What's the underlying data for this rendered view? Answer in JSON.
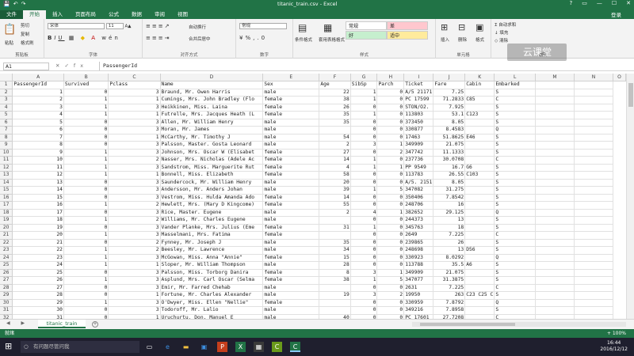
{
  "window": {
    "title": "titanic_train.csv - Excel",
    "login": "登录",
    "qat_icons": [
      "save-icon",
      "undo-icon",
      "redo-icon"
    ],
    "controls": [
      "?",
      "▭",
      "—",
      "☐",
      "✕"
    ]
  },
  "tabs": [
    "文件",
    "开始",
    "插入",
    "页面布局",
    "公式",
    "数据",
    "审阅",
    "视图"
  ],
  "active_tab": "开始",
  "ribbon": {
    "clipboard": {
      "label": "剪贴板",
      "paste": "粘贴",
      "cut": "剪切",
      "copy": "复制",
      "format_painter": "格式刷"
    },
    "font": {
      "label": "字体",
      "name": "宋体",
      "size": "11"
    },
    "alignment": {
      "label": "对齐方式",
      "wrap": "自动换行",
      "merge": "合并后居中"
    },
    "number": {
      "label": "数字",
      "format": "常规"
    },
    "styles": {
      "label": "样式",
      "cond_format": "条件格式",
      "table_format": "套用表格格式",
      "cells": [
        {
          "text": "常规",
          "bg": "#ffffff"
        },
        {
          "text": "差",
          "bg": "#ffc7ce"
        },
        {
          "text": "好",
          "bg": "#c6efce"
        },
        {
          "text": "适中",
          "bg": "#ffeb9c"
        }
      ]
    },
    "cells_grp": {
      "label": "单元格",
      "insert": "插入",
      "delete": "删除",
      "format": "格式"
    },
    "editing": {
      "label": "编辑",
      "autosum": "自动求和",
      "fill": "填充",
      "clear": "清除"
    },
    "brand": "云课堂"
  },
  "formula_bar": {
    "name_box": "A1",
    "value": "PassengerId"
  },
  "grid": {
    "columns": [
      "A",
      "B",
      "C",
      "D",
      "E",
      "F",
      "G",
      "H",
      "I",
      "J",
      "K",
      "L",
      "M",
      "N",
      "O"
    ],
    "rows": [
      [
        "1",
        "PassengerId",
        "Survived",
        "Pclass",
        "Name",
        "Sex",
        "Age",
        "SibSp",
        "Parch",
        "Ticket",
        "Fare",
        "Cabin",
        "Embarked",
        "",
        ""
      ],
      [
        "2",
        "1",
        "0",
        "3",
        "Braund, Mr. Owen Harris",
        "male",
        "22",
        "1",
        "0",
        "A/5 21171",
        "7.25",
        "",
        "S",
        "",
        ""
      ],
      [
        "3",
        "2",
        "1",
        "1",
        "Cumings, Mrs. John Bradley (Flo",
        "female",
        "38",
        "1",
        "0",
        "PC 17599",
        "71.2833",
        "C85",
        "C",
        "",
        ""
      ],
      [
        "4",
        "3",
        "1",
        "3",
        "Heikkinen, Miss. Laina",
        "female",
        "26",
        "0",
        "0",
        "STON/O2.",
        "7.925",
        "",
        "S",
        "",
        ""
      ],
      [
        "5",
        "4",
        "1",
        "1",
        "Futrelle, Mrs. Jacques Heath (L",
        "female",
        "35",
        "1",
        "0",
        "113803",
        "53.1",
        "C123",
        "S",
        "",
        ""
      ],
      [
        "6",
        "5",
        "0",
        "3",
        "Allen, Mr. William Henry",
        "male",
        "35",
        "0",
        "0",
        "373450",
        "8.05",
        "",
        "S",
        "",
        ""
      ],
      [
        "7",
        "6",
        "0",
        "3",
        "Moran, Mr. James",
        "male",
        "",
        "0",
        "0",
        "330877",
        "8.4583",
        "",
        "Q",
        "",
        ""
      ],
      [
        "8",
        "7",
        "0",
        "1",
        "McCarthy, Mr. Timothy J",
        "male",
        "54",
        "0",
        "0",
        "17463",
        "51.8625",
        "E46",
        "S",
        "",
        ""
      ],
      [
        "9",
        "8",
        "0",
        "3",
        "Palsson, Master. Gosta Leonard",
        "male",
        "2",
        "3",
        "1",
        "349909",
        "21.075",
        "",
        "S",
        "",
        ""
      ],
      [
        "10",
        "9",
        "1",
        "3",
        "Johnson, Mrs. Oscar W (Elisabet",
        "female",
        "27",
        "0",
        "2",
        "347742",
        "11.1333",
        "",
        "S",
        "",
        ""
      ],
      [
        "11",
        "10",
        "1",
        "2",
        "Nasser, Mrs. Nicholas (Adele Ac",
        "female",
        "14",
        "1",
        "0",
        "237736",
        "30.0708",
        "",
        "C",
        "",
        ""
      ],
      [
        "12",
        "11",
        "1",
        "3",
        "Sandstrom, Miss. Marguerite Rut",
        "female",
        "4",
        "1",
        "1",
        "PP 9549",
        "16.7",
        "G6",
        "S",
        "",
        ""
      ],
      [
        "13",
        "12",
        "1",
        "1",
        "Bonnell, Miss. Elizabeth",
        "female",
        "58",
        "0",
        "0",
        "113783",
        "26.55",
        "C103",
        "S",
        "",
        ""
      ],
      [
        "14",
        "13",
        "0",
        "3",
        "Saundercock, Mr. William Henry",
        "male",
        "20",
        "0",
        "0",
        "A/5. 2151",
        "8.05",
        "",
        "S",
        "",
        ""
      ],
      [
        "15",
        "14",
        "0",
        "3",
        "Andersson, Mr. Anders Johan",
        "male",
        "39",
        "1",
        "5",
        "347082",
        "31.275",
        "",
        "S",
        "",
        ""
      ],
      [
        "16",
        "15",
        "0",
        "3",
        "Vestrom, Miss. Hulda Amanda Ado",
        "female",
        "14",
        "0",
        "0",
        "350406",
        "7.8542",
        "",
        "S",
        "",
        ""
      ],
      [
        "17",
        "16",
        "1",
        "2",
        "Hewlett, Mrs. (Mary D Kingcome)",
        "female",
        "55",
        "0",
        "0",
        "248706",
        "16",
        "",
        "S",
        "",
        ""
      ],
      [
        "18",
        "17",
        "0",
        "3",
        "Rice, Master. Eugene",
        "male",
        "2",
        "4",
        "1",
        "382652",
        "29.125",
        "",
        "Q",
        "",
        ""
      ],
      [
        "19",
        "18",
        "1",
        "2",
        "Williams, Mr. Charles Eugene",
        "male",
        "",
        "0",
        "0",
        "244373",
        "13",
        "",
        "S",
        "",
        ""
      ],
      [
        "20",
        "19",
        "0",
        "3",
        "Vander Planke, Mrs. Julius (Eme",
        "female",
        "31",
        "1",
        "0",
        "345763",
        "18",
        "",
        "S",
        "",
        ""
      ],
      [
        "21",
        "20",
        "1",
        "3",
        "Masselmani, Mrs. Fatima",
        "female",
        "",
        "0",
        "0",
        "2649",
        "7.225",
        "",
        "C",
        "",
        ""
      ],
      [
        "22",
        "21",
        "0",
        "2",
        "Fynney, Mr. Joseph J",
        "male",
        "35",
        "0",
        "0",
        "239865",
        "26",
        "",
        "S",
        "",
        ""
      ],
      [
        "23",
        "22",
        "1",
        "2",
        "Beesley, Mr. Lawrence",
        "male",
        "34",
        "0",
        "0",
        "248698",
        "13",
        "D56",
        "S",
        "",
        ""
      ],
      [
        "24",
        "23",
        "1",
        "3",
        "McGowan, Miss. Anna \"Annie\"",
        "female",
        "15",
        "0",
        "0",
        "330923",
        "8.0292",
        "",
        "Q",
        "",
        ""
      ],
      [
        "25",
        "24",
        "1",
        "1",
        "Sloper, Mr. William Thompson",
        "male",
        "28",
        "0",
        "0",
        "113788",
        "35.5",
        "A6",
        "S",
        "",
        ""
      ],
      [
        "26",
        "25",
        "0",
        "3",
        "Palsson, Miss. Torborg Danira",
        "female",
        "8",
        "3",
        "1",
        "349909",
        "21.075",
        "",
        "S",
        "",
        ""
      ],
      [
        "27",
        "26",
        "1",
        "3",
        "Asplund, Mrs. Carl Oscar (Selma",
        "female",
        "38",
        "1",
        "5",
        "347077",
        "31.3875",
        "",
        "S",
        "",
        ""
      ],
      [
        "28",
        "27",
        "0",
        "3",
        "Emir, Mr. Farred Chehab",
        "male",
        "",
        "0",
        "0",
        "2631",
        "7.225",
        "",
        "C",
        "",
        ""
      ],
      [
        "29",
        "28",
        "0",
        "1",
        "Fortune, Mr. Charles Alexander",
        "male",
        "19",
        "3",
        "2",
        "19950",
        "263",
        "C23 C25 C",
        "S",
        "",
        ""
      ],
      [
        "30",
        "29",
        "1",
        "3",
        "O'Dwyer, Miss. Ellen \"Nellie\"",
        "female",
        "",
        "0",
        "0",
        "330959",
        "7.8792",
        "",
        "Q",
        "",
        ""
      ],
      [
        "31",
        "30",
        "0",
        "3",
        "Todoroff, Mr. Lalio",
        "male",
        "",
        "0",
        "0",
        "349216",
        "7.8958",
        "",
        "S",
        "",
        ""
      ],
      [
        "32",
        "31",
        "0",
        "1",
        "Uruchurtu, Don. Manuel E",
        "male",
        "40",
        "0",
        "0",
        "PC 17601",
        "27.7208",
        "",
        "C",
        "",
        ""
      ],
      [
        "33",
        "32",
        "1",
        "1",
        "Spencer, Mrs. William Augustus",
        "female",
        "",
        "1",
        "0",
        "PC 17569",
        "146.5208",
        "B78",
        "C",
        "",
        ""
      ]
    ]
  },
  "sheet": {
    "tab": "titanic_train",
    "add": "+",
    "nav": "◀ ▶"
  },
  "status": {
    "ready": "就绪",
    "zoom": "+ 100%"
  },
  "taskbar": {
    "search": "有问题尽管问我",
    "time": "16:44",
    "date": "2016/12/12",
    "icons": [
      "task-view-icon",
      "edge-icon",
      "explorer-icon",
      "store-icon",
      "powerpoint-icon",
      "excel-icon",
      "app-icon",
      "camtasia-icon",
      "excel-active-icon"
    ]
  }
}
